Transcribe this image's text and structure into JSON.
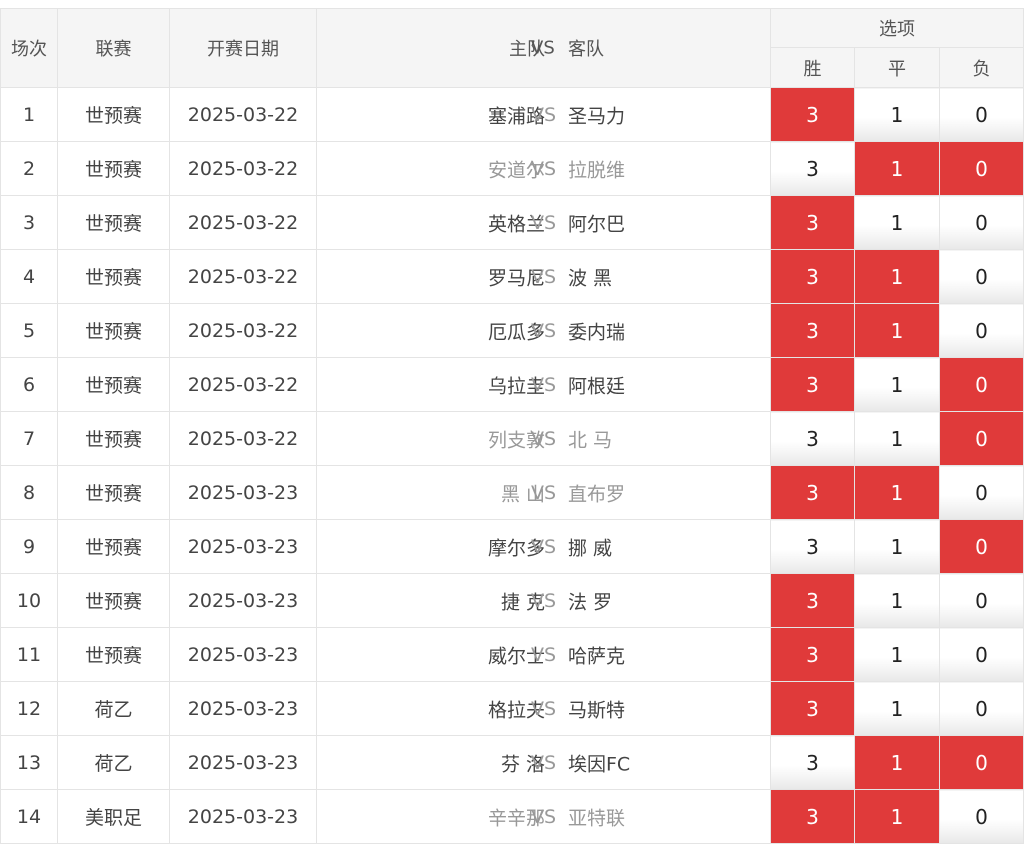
{
  "header": {
    "col_round": "场次",
    "col_league": "联赛",
    "col_date": "开赛日期",
    "col_home": "主队",
    "col_vs": "VS",
    "col_away": "客队",
    "col_options": "选项",
    "opt_win": "胜",
    "opt_draw": "平",
    "opt_lose": "负"
  },
  "accent_color": "#e03a3a",
  "rows": [
    {
      "no": "1",
      "league": "世预赛",
      "date": "2025-03-22",
      "home": "塞浦路",
      "away": "圣马力",
      "dim": false,
      "opts": [
        "3",
        "1",
        "0"
      ],
      "sel": [
        true,
        false,
        false
      ]
    },
    {
      "no": "2",
      "league": "世预赛",
      "date": "2025-03-22",
      "home": "安道尔",
      "away": "拉脱维",
      "dim": true,
      "opts": [
        "3",
        "1",
        "0"
      ],
      "sel": [
        false,
        true,
        true
      ]
    },
    {
      "no": "3",
      "league": "世预赛",
      "date": "2025-03-22",
      "home": "英格兰",
      "away": "阿尔巴",
      "dim": false,
      "opts": [
        "3",
        "1",
        "0"
      ],
      "sel": [
        true,
        false,
        false
      ]
    },
    {
      "no": "4",
      "league": "世预赛",
      "date": "2025-03-22",
      "home": "罗马尼",
      "away": "波 黑",
      "dim": false,
      "opts": [
        "3",
        "1",
        "0"
      ],
      "sel": [
        true,
        true,
        false
      ]
    },
    {
      "no": "5",
      "league": "世预赛",
      "date": "2025-03-22",
      "home": "厄瓜多",
      "away": "委内瑞",
      "dim": false,
      "opts": [
        "3",
        "1",
        "0"
      ],
      "sel": [
        true,
        true,
        false
      ]
    },
    {
      "no": "6",
      "league": "世预赛",
      "date": "2025-03-22",
      "home": "乌拉圭",
      "away": "阿根廷",
      "dim": false,
      "opts": [
        "3",
        "1",
        "0"
      ],
      "sel": [
        true,
        false,
        true
      ]
    },
    {
      "no": "7",
      "league": "世预赛",
      "date": "2025-03-22",
      "home": "列支敦",
      "away": "北 马",
      "dim": true,
      "opts": [
        "3",
        "1",
        "0"
      ],
      "sel": [
        false,
        false,
        true
      ]
    },
    {
      "no": "8",
      "league": "世预赛",
      "date": "2025-03-23",
      "home": "黑 山",
      "away": "直布罗",
      "dim": true,
      "opts": [
        "3",
        "1",
        "0"
      ],
      "sel": [
        true,
        true,
        false
      ]
    },
    {
      "no": "9",
      "league": "世预赛",
      "date": "2025-03-23",
      "home": "摩尔多",
      "away": "挪 威",
      "dim": false,
      "opts": [
        "3",
        "1",
        "0"
      ],
      "sel": [
        false,
        false,
        true
      ]
    },
    {
      "no": "10",
      "league": "世预赛",
      "date": "2025-03-23",
      "home": "捷 克",
      "away": "法 罗",
      "dim": false,
      "opts": [
        "3",
        "1",
        "0"
      ],
      "sel": [
        true,
        false,
        false
      ]
    },
    {
      "no": "11",
      "league": "世预赛",
      "date": "2025-03-23",
      "home": "威尔士",
      "away": "哈萨克",
      "dim": false,
      "opts": [
        "3",
        "1",
        "0"
      ],
      "sel": [
        true,
        false,
        false
      ]
    },
    {
      "no": "12",
      "league": "荷乙",
      "date": "2025-03-23",
      "home": "格拉夫",
      "away": "马斯特",
      "dim": false,
      "opts": [
        "3",
        "1",
        "0"
      ],
      "sel": [
        true,
        false,
        false
      ]
    },
    {
      "no": "13",
      "league": "荷乙",
      "date": "2025-03-23",
      "home": "芬 洛",
      "away": "埃因FC",
      "dim": false,
      "opts": [
        "3",
        "1",
        "0"
      ],
      "sel": [
        false,
        true,
        true
      ]
    },
    {
      "no": "14",
      "league": "美职足",
      "date": "2025-03-23",
      "home": "辛辛那",
      "away": "亚特联",
      "dim": true,
      "opts": [
        "3",
        "1",
        "0"
      ],
      "sel": [
        true,
        true,
        false
      ]
    }
  ]
}
